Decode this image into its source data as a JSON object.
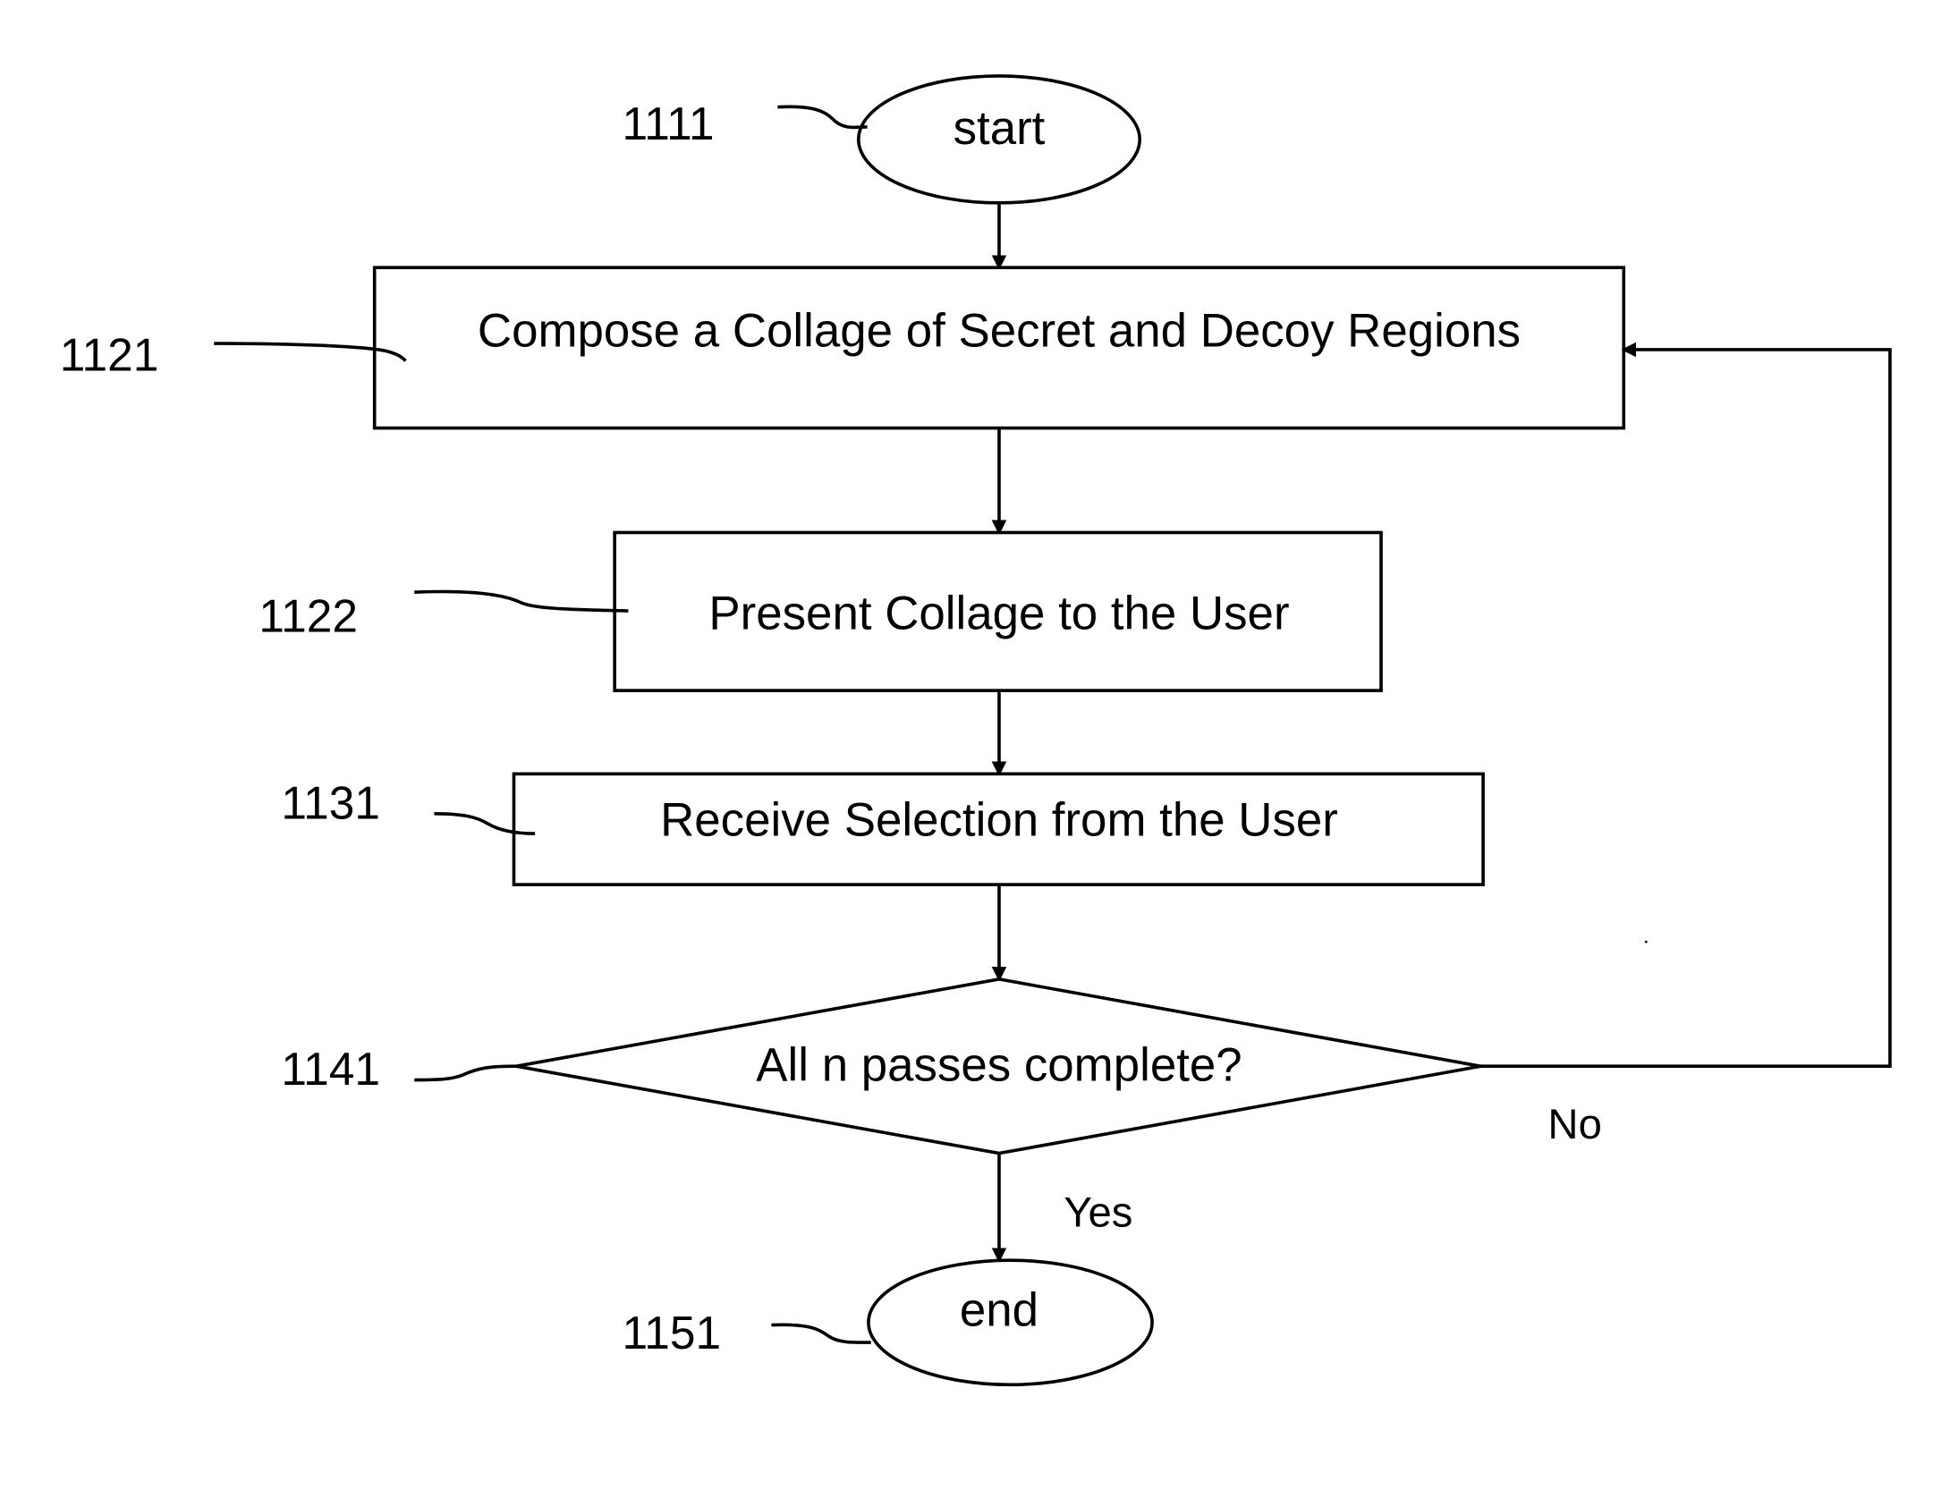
{
  "diagram": {
    "type": "flowchart",
    "nodes": [
      {
        "id": "1111",
        "ref": "1111",
        "shape": "terminal",
        "text": "start"
      },
      {
        "id": "1121",
        "ref": "1121",
        "shape": "process",
        "text": "Compose a Collage of Secret and Decoy Regions"
      },
      {
        "id": "1122",
        "ref": "1122",
        "shape": "process",
        "text": "Present Collage to the User"
      },
      {
        "id": "1131",
        "ref": "1131",
        "shape": "process",
        "text": "Receive Selection from the User"
      },
      {
        "id": "1141",
        "ref": "1141",
        "shape": "decision",
        "text": "All n passes complete?"
      },
      {
        "id": "1151",
        "ref": "1151",
        "shape": "terminal",
        "text": "end"
      }
    ],
    "edges": [
      {
        "from": "1111",
        "to": "1121",
        "label": ""
      },
      {
        "from": "1121",
        "to": "1122",
        "label": ""
      },
      {
        "from": "1122",
        "to": "1131",
        "label": ""
      },
      {
        "from": "1131",
        "to": "1141",
        "label": ""
      },
      {
        "from": "1141",
        "to": "1151",
        "label": "Yes"
      },
      {
        "from": "1141",
        "to": "1121",
        "label": "No"
      }
    ],
    "branch_labels": {
      "yes": "Yes",
      "no": "No"
    }
  }
}
